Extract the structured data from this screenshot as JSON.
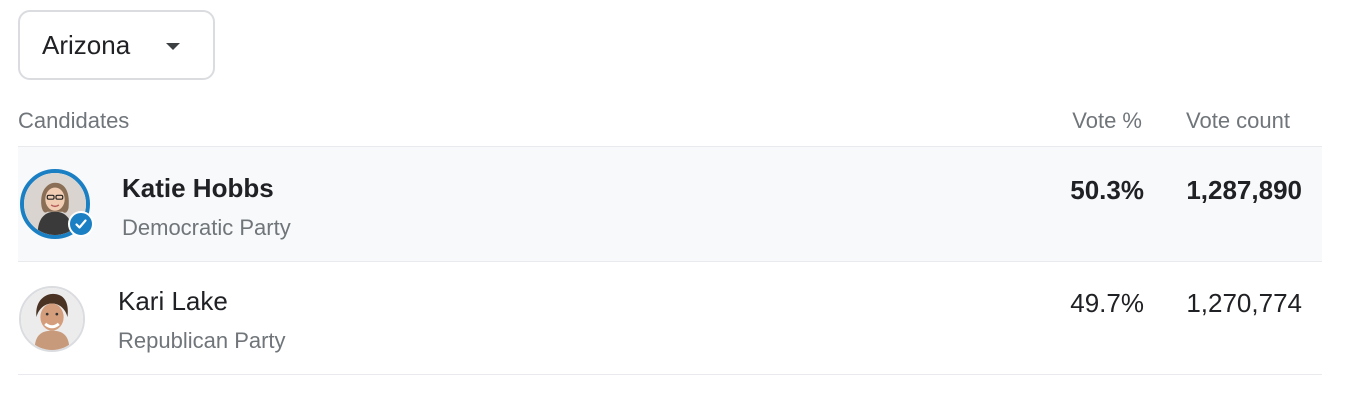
{
  "state_select": {
    "selected": "Arizona",
    "icon": "caret-down-icon"
  },
  "table": {
    "headers": {
      "candidates": "Candidates",
      "vote_pct": "Vote %",
      "vote_count": "Vote count"
    },
    "rows": [
      {
        "name": "Katie Hobbs",
        "party": "Democratic Party",
        "vote_pct": "50.3%",
        "vote_count": "1,287,890",
        "winner": true,
        "winner_icon": "checkmark-icon",
        "accent_color": "#1b7fc4"
      },
      {
        "name": "Kari Lake",
        "party": "Republican Party",
        "vote_pct": "49.7%",
        "vote_count": "1,270,774",
        "winner": false
      }
    ]
  }
}
